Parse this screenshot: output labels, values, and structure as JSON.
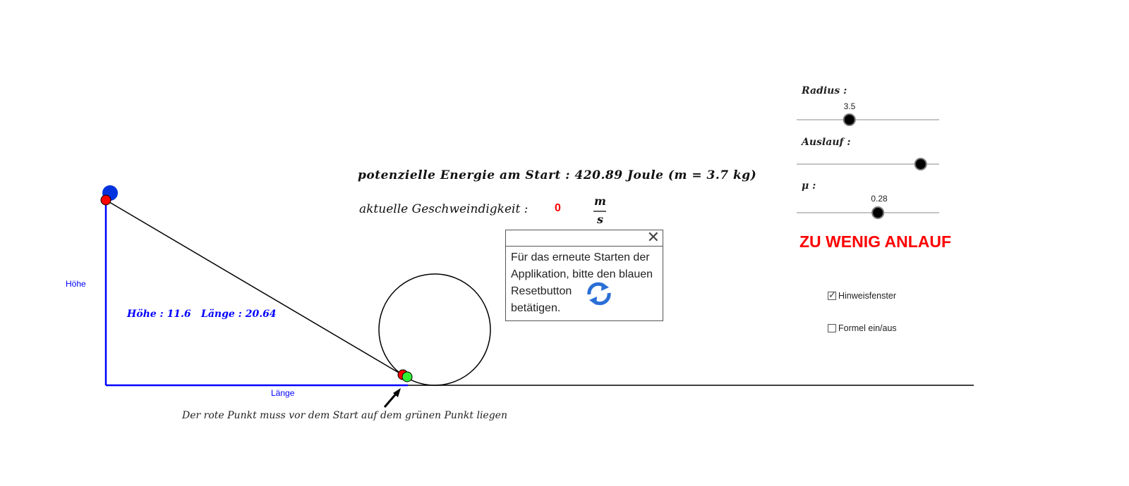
{
  "labels": {
    "hoehe_axis": "Höhe",
    "laenge_axis": "Länge",
    "hoehe_value_text": "Höhe : 11.6",
    "laenge_value_text": "Länge : 20.64",
    "instruction": "Der rote Punkt muss vor dem Start auf dem grünen Punkt liegen"
  },
  "energy": {
    "text": "potenzielle Energie am Start : 420.89 Joule (m = 3.7 kg)"
  },
  "speed": {
    "label": "aktuelle Geschweindigkeit :",
    "value": "0",
    "unit_numerator": "m",
    "unit_denominator": "s"
  },
  "popup": {
    "line1": "Für das erneute Starten der",
    "line2": "Applikation, bitte den blauen",
    "line3": "Resetbutton",
    "line4": "betätigen.",
    "close_icon": "✕"
  },
  "sliders": {
    "radius": {
      "label": "Radius :",
      "value": "3.5",
      "fraction": 0.37
    },
    "auslauf": {
      "label": "Auslauf :",
      "fraction": 0.87
    },
    "mu": {
      "label": "μ :",
      "value": "0.28",
      "fraction": 0.57
    }
  },
  "status": {
    "text": "ZU WENIG ANLAUF",
    "color": "#ff0000"
  },
  "checkboxes": [
    {
      "label": "Hinweisfenster",
      "checked": true
    },
    {
      "label": "Formel ein/aus",
      "checked": false
    }
  ],
  "colors": {
    "blue": "#0000ff",
    "red": "#ff0000",
    "green": "#33ee33",
    "track": "#000000"
  },
  "icons": {
    "reset": "reset-icon"
  }
}
